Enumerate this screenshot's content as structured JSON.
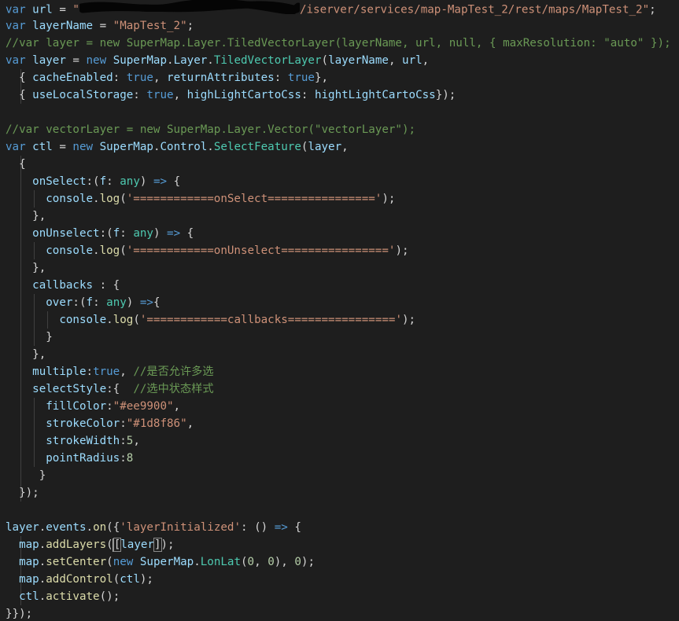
{
  "colors": {
    "background": "#1e1e1e",
    "keyword": "#569cd6",
    "variable": "#9cdcfe",
    "string": "#ce9178",
    "comment": "#6a9955",
    "class": "#4ec9b0",
    "function": "#dcdcaa",
    "number": "#b5cea8",
    "text": "#d4d4d4"
  },
  "editor": {
    "lines": [
      [
        [
          "kw",
          "var"
        ],
        [
          "txt",
          " "
        ],
        [
          "var",
          "url"
        ],
        [
          "txt",
          " = "
        ],
        [
          "str",
          "\""
        ],
        [
          "redact",
          ""
        ],
        [
          "str",
          "/iserver/services/map-MapTest_2/rest/maps/MapTest_2\""
        ],
        [
          "txt",
          ";"
        ]
      ],
      [
        [
          "kw",
          "var"
        ],
        [
          "txt",
          " "
        ],
        [
          "var",
          "layerName"
        ],
        [
          "txt",
          " = "
        ],
        [
          "str",
          "\"MapTest_2\""
        ],
        [
          "txt",
          ";"
        ]
      ],
      [
        [
          "cmt",
          "//var layer = new SuperMap.Layer.TiledVectorLayer(layerName, url, null, { maxResolution: \"auto\" });"
        ]
      ],
      [
        [
          "kw",
          "var"
        ],
        [
          "txt",
          " "
        ],
        [
          "var",
          "layer"
        ],
        [
          "txt",
          " = "
        ],
        [
          "kw",
          "new"
        ],
        [
          "txt",
          " "
        ],
        [
          "var",
          "SuperMap"
        ],
        [
          "txt",
          "."
        ],
        [
          "var",
          "Layer"
        ],
        [
          "txt",
          "."
        ],
        [
          "cls",
          "TiledVectorLayer"
        ],
        [
          "txt",
          "("
        ],
        [
          "var",
          "layerName"
        ],
        [
          "txt",
          ", "
        ],
        [
          "var",
          "url"
        ],
        [
          "txt",
          ","
        ]
      ],
      [
        [
          "txt",
          "  { "
        ],
        [
          "var",
          "cacheEnabled"
        ],
        [
          "txt",
          ": "
        ],
        [
          "kw",
          "true"
        ],
        [
          "txt",
          ", "
        ],
        [
          "var",
          "returnAttributes"
        ],
        [
          "txt",
          ": "
        ],
        [
          "kw",
          "true"
        ],
        [
          "txt",
          "},"
        ]
      ],
      [
        [
          "txt",
          "  { "
        ],
        [
          "var",
          "useLocalStorage"
        ],
        [
          "txt",
          ": "
        ],
        [
          "kw",
          "true"
        ],
        [
          "txt",
          ", "
        ],
        [
          "var",
          "highLightCartoCss"
        ],
        [
          "txt",
          ": "
        ],
        [
          "var",
          "hightLightCartoCss"
        ],
        [
          "txt",
          "});"
        ]
      ],
      [],
      [
        [
          "cmt",
          "//var vectorLayer = new SuperMap.Layer.Vector(\"vectorLayer\");"
        ]
      ],
      [
        [
          "kw",
          "var"
        ],
        [
          "txt",
          " "
        ],
        [
          "var",
          "ctl"
        ],
        [
          "txt",
          " = "
        ],
        [
          "kw",
          "new"
        ],
        [
          "txt",
          " "
        ],
        [
          "var",
          "SuperMap"
        ],
        [
          "txt",
          "."
        ],
        [
          "var",
          "Control"
        ],
        [
          "txt",
          "."
        ],
        [
          "cls",
          "SelectFeature"
        ],
        [
          "txt",
          "("
        ],
        [
          "var",
          "layer"
        ],
        [
          "txt",
          ","
        ]
      ],
      [
        [
          "txt",
          "  {"
        ]
      ],
      [
        [
          "txt",
          "    "
        ],
        [
          "var",
          "onSelect"
        ],
        [
          "txt",
          ":("
        ],
        [
          "var",
          "f"
        ],
        [
          "txt",
          ": "
        ],
        [
          "cls",
          "any"
        ],
        [
          "txt",
          ") "
        ],
        [
          "kw",
          "=>"
        ],
        [
          "txt",
          " {"
        ]
      ],
      [
        [
          "txt",
          "      "
        ],
        [
          "var",
          "console"
        ],
        [
          "txt",
          "."
        ],
        [
          "fn",
          "log"
        ],
        [
          "txt",
          "("
        ],
        [
          "str",
          "'============onSelect================'"
        ],
        [
          "txt",
          ");"
        ]
      ],
      [
        [
          "txt",
          "    },"
        ]
      ],
      [
        [
          "txt",
          "    "
        ],
        [
          "var",
          "onUnselect"
        ],
        [
          "txt",
          ":("
        ],
        [
          "var",
          "f"
        ],
        [
          "txt",
          ": "
        ],
        [
          "cls",
          "any"
        ],
        [
          "txt",
          ") "
        ],
        [
          "kw",
          "=>"
        ],
        [
          "txt",
          " {"
        ]
      ],
      [
        [
          "txt",
          "      "
        ],
        [
          "var",
          "console"
        ],
        [
          "txt",
          "."
        ],
        [
          "fn",
          "log"
        ],
        [
          "txt",
          "("
        ],
        [
          "str",
          "'============onUnselect================'"
        ],
        [
          "txt",
          ");"
        ]
      ],
      [
        [
          "txt",
          "    },"
        ]
      ],
      [
        [
          "txt",
          "    "
        ],
        [
          "var",
          "callbacks"
        ],
        [
          "txt",
          " : {"
        ]
      ],
      [
        [
          "txt",
          "      "
        ],
        [
          "var",
          "over"
        ],
        [
          "txt",
          ":("
        ],
        [
          "var",
          "f"
        ],
        [
          "txt",
          ": "
        ],
        [
          "cls",
          "any"
        ],
        [
          "txt",
          ") "
        ],
        [
          "kw",
          "=>"
        ],
        [
          "txt",
          "{"
        ]
      ],
      [
        [
          "txt",
          "        "
        ],
        [
          "var",
          "console"
        ],
        [
          "txt",
          "."
        ],
        [
          "fn",
          "log"
        ],
        [
          "txt",
          "("
        ],
        [
          "str",
          "'============callbacks================'"
        ],
        [
          "txt",
          ");"
        ]
      ],
      [
        [
          "txt",
          "      }"
        ]
      ],
      [
        [
          "txt",
          "    },"
        ]
      ],
      [
        [
          "txt",
          "    "
        ],
        [
          "var",
          "multiple"
        ],
        [
          "txt",
          ":"
        ],
        [
          "kw",
          "true"
        ],
        [
          "txt",
          ", "
        ],
        [
          "cmt",
          "//是否允许多选"
        ]
      ],
      [
        [
          "txt",
          "    "
        ],
        [
          "var",
          "selectStyle"
        ],
        [
          "txt",
          ":{  "
        ],
        [
          "cmt",
          "//选中状态样式"
        ]
      ],
      [
        [
          "txt",
          "      "
        ],
        [
          "var",
          "fillColor"
        ],
        [
          "txt",
          ":"
        ],
        [
          "str",
          "\"#ee9900\""
        ],
        [
          "txt",
          ","
        ]
      ],
      [
        [
          "txt",
          "      "
        ],
        [
          "var",
          "strokeColor"
        ],
        [
          "txt",
          ":"
        ],
        [
          "str",
          "\"#1d8f86\""
        ],
        [
          "txt",
          ","
        ]
      ],
      [
        [
          "txt",
          "      "
        ],
        [
          "var",
          "strokeWidth"
        ],
        [
          "txt",
          ":"
        ],
        [
          "num",
          "5"
        ],
        [
          "txt",
          ","
        ]
      ],
      [
        [
          "txt",
          "      "
        ],
        [
          "var",
          "pointRadius"
        ],
        [
          "txt",
          ":"
        ],
        [
          "num",
          "8"
        ]
      ],
      [
        [
          "txt",
          "     }"
        ]
      ],
      [
        [
          "txt",
          "  });"
        ]
      ],
      [],
      [
        [
          "var",
          "layer"
        ],
        [
          "txt",
          "."
        ],
        [
          "var",
          "events"
        ],
        [
          "txt",
          "."
        ],
        [
          "fn",
          "on"
        ],
        [
          "txt",
          "({"
        ],
        [
          "str",
          "'layerInitialized'"
        ],
        [
          "txt",
          ": () "
        ],
        [
          "kw",
          "=>"
        ],
        [
          "txt",
          " {"
        ]
      ],
      [
        [
          "txt",
          "  "
        ],
        [
          "var",
          "map"
        ],
        [
          "txt",
          "."
        ],
        [
          "fn",
          "addLayers"
        ],
        [
          "txt",
          "("
        ],
        [
          "box",
          "["
        ],
        [
          "var",
          "layer"
        ],
        [
          "box",
          "]"
        ],
        [
          "txt",
          ");"
        ]
      ],
      [
        [
          "txt",
          "  "
        ],
        [
          "var",
          "map"
        ],
        [
          "txt",
          "."
        ],
        [
          "fn",
          "setCenter"
        ],
        [
          "txt",
          "("
        ],
        [
          "kw",
          "new"
        ],
        [
          "txt",
          " "
        ],
        [
          "var",
          "SuperMap"
        ],
        [
          "txt",
          "."
        ],
        [
          "cls",
          "LonLat"
        ],
        [
          "txt",
          "("
        ],
        [
          "num",
          "0"
        ],
        [
          "txt",
          ", "
        ],
        [
          "num",
          "0"
        ],
        [
          "txt",
          "), "
        ],
        [
          "num",
          "0"
        ],
        [
          "txt",
          ");"
        ]
      ],
      [
        [
          "txt",
          "  "
        ],
        [
          "var",
          "map"
        ],
        [
          "txt",
          "."
        ],
        [
          "fn",
          "addControl"
        ],
        [
          "txt",
          "("
        ],
        [
          "var",
          "ctl"
        ],
        [
          "txt",
          ");"
        ]
      ],
      [
        [
          "txt",
          "  "
        ],
        [
          "var",
          "ctl"
        ],
        [
          "txt",
          "."
        ],
        [
          "fn",
          "activate"
        ],
        [
          "txt",
          "();"
        ]
      ],
      [
        [
          "txt",
          "}});"
        ]
      ]
    ]
  }
}
